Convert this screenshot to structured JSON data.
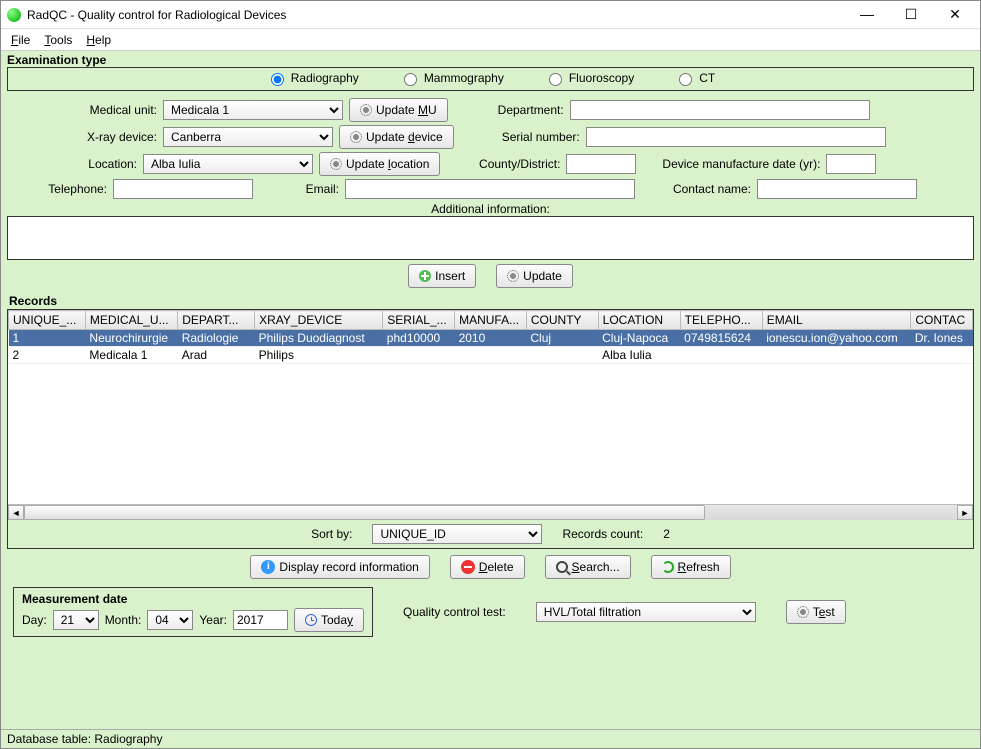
{
  "window": {
    "title": "RadQC - Quality control for Radiological Devices"
  },
  "menu": {
    "file": "File",
    "tools": "Tools",
    "help": "Help"
  },
  "exam": {
    "legend": "Examination type",
    "radiography": "Radiography",
    "mammography": "Mammography",
    "fluoroscopy": "Fluoroscopy",
    "ct": "CT"
  },
  "form": {
    "medical_unit_lbl": "Medical unit:",
    "medical_unit_val": "Medicala 1",
    "update_mu": "Update MU",
    "department_lbl": "Department:",
    "xray_lbl": "X-ray device:",
    "xray_val": "Canberra",
    "update_device": "Update device",
    "serial_lbl": "Serial number:",
    "location_lbl": "Location:",
    "location_val": "Alba Iulia",
    "update_location": "Update location",
    "county_lbl": "County/District:",
    "mfg_date_lbl": "Device manufacture date (yr):",
    "telephone_lbl": "Telephone:",
    "email_lbl": "Email:",
    "contact_lbl": "Contact name:",
    "additional_lbl": "Additional information:",
    "insert": "Insert",
    "update": "Update"
  },
  "records": {
    "legend": "Records",
    "headers": [
      "UNIQUE_...",
      "MEDICAL_U...",
      "DEPART...",
      "XRAY_DEVICE",
      "SERIAL_...",
      "MANUFA...",
      "COUNTY",
      "LOCATION",
      "TELEPHO...",
      "EMAIL",
      "CONTAC"
    ],
    "rows": [
      {
        "c0": "1",
        "c1": "Neurochirurgie",
        "c2": "Radiologie",
        "c3": "Philips Duodiagnost",
        "c4": "phd10000",
        "c5": "2010",
        "c6": "Cluj",
        "c7": "Cluj-Napoca",
        "c8": "0749815624",
        "c9": "ionescu.ion@yahoo.com",
        "c10": "Dr. Iones"
      },
      {
        "c0": "2",
        "c1": "Medicala 1",
        "c2": "Arad",
        "c3": "Philips",
        "c4": "",
        "c5": "",
        "c6": "",
        "c7": "Alba Iulia",
        "c8": "",
        "c9": "",
        "c10": ""
      }
    ],
    "sort_lbl": "Sort by:",
    "sort_val": "UNIQUE_ID",
    "count_lbl": "Records count:",
    "count_val": "2"
  },
  "actions": {
    "display": "Display record information",
    "delete": "Delete",
    "search": "Search...",
    "refresh": "Refresh"
  },
  "meas": {
    "legend": "Measurement date",
    "day_lbl": "Day:",
    "day_val": "21",
    "month_lbl": "Month:",
    "month_val": "04",
    "year_lbl": "Year:",
    "year_val": "2017",
    "today": "Today"
  },
  "qc": {
    "label": "Quality control test:",
    "value": "HVL/Total filtration",
    "test_btn": "Test"
  },
  "status": "Database table: Radiography"
}
